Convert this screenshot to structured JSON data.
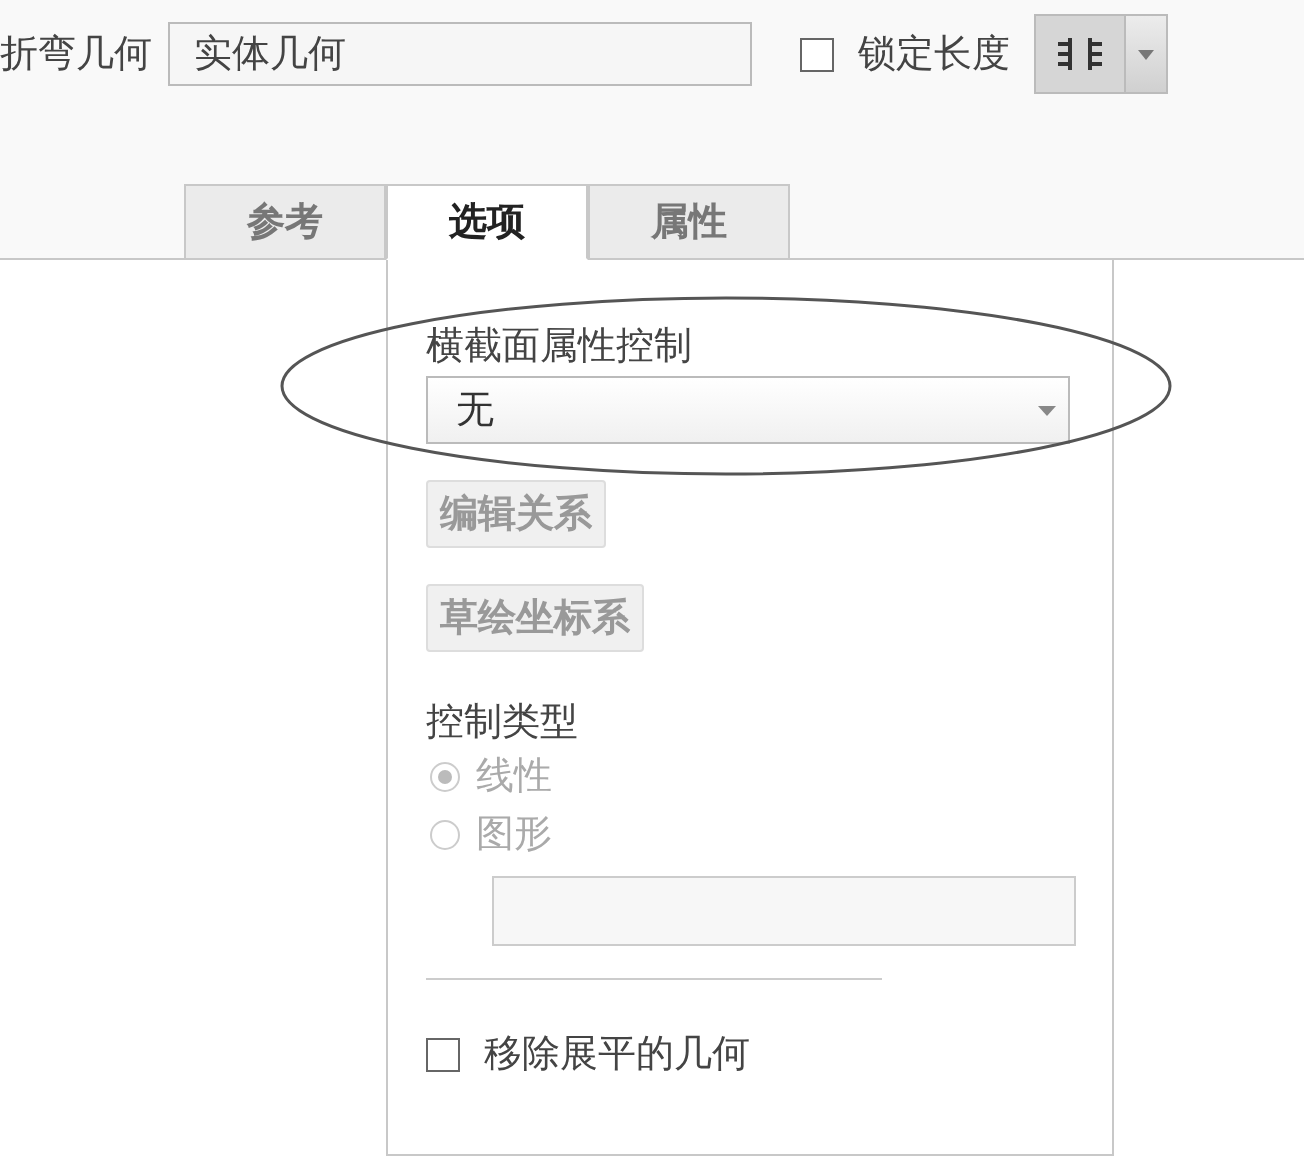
{
  "toolbar": {
    "label": "折弯几何",
    "value": "实体几何",
    "lock_length": {
      "label": "锁定长度",
      "checked": false
    }
  },
  "tabs": [
    {
      "label": "参考",
      "selected": false
    },
    {
      "label": "选项",
      "selected": true
    },
    {
      "label": "属性",
      "selected": false
    }
  ],
  "options": {
    "section_control": {
      "label": "横截面属性控制",
      "value": "无",
      "highlighted": true
    },
    "buttons": [
      {
        "label": "编辑关系",
        "disabled": true
      },
      {
        "label": "草绘坐标系",
        "disabled": true
      }
    ],
    "control_type": {
      "label": "控制类型",
      "options": [
        {
          "label": "线性",
          "selected": true
        },
        {
          "label": "图形",
          "selected": false
        }
      ]
    },
    "remove_flat": {
      "label": "移除展平的几何",
      "checked": false
    }
  }
}
